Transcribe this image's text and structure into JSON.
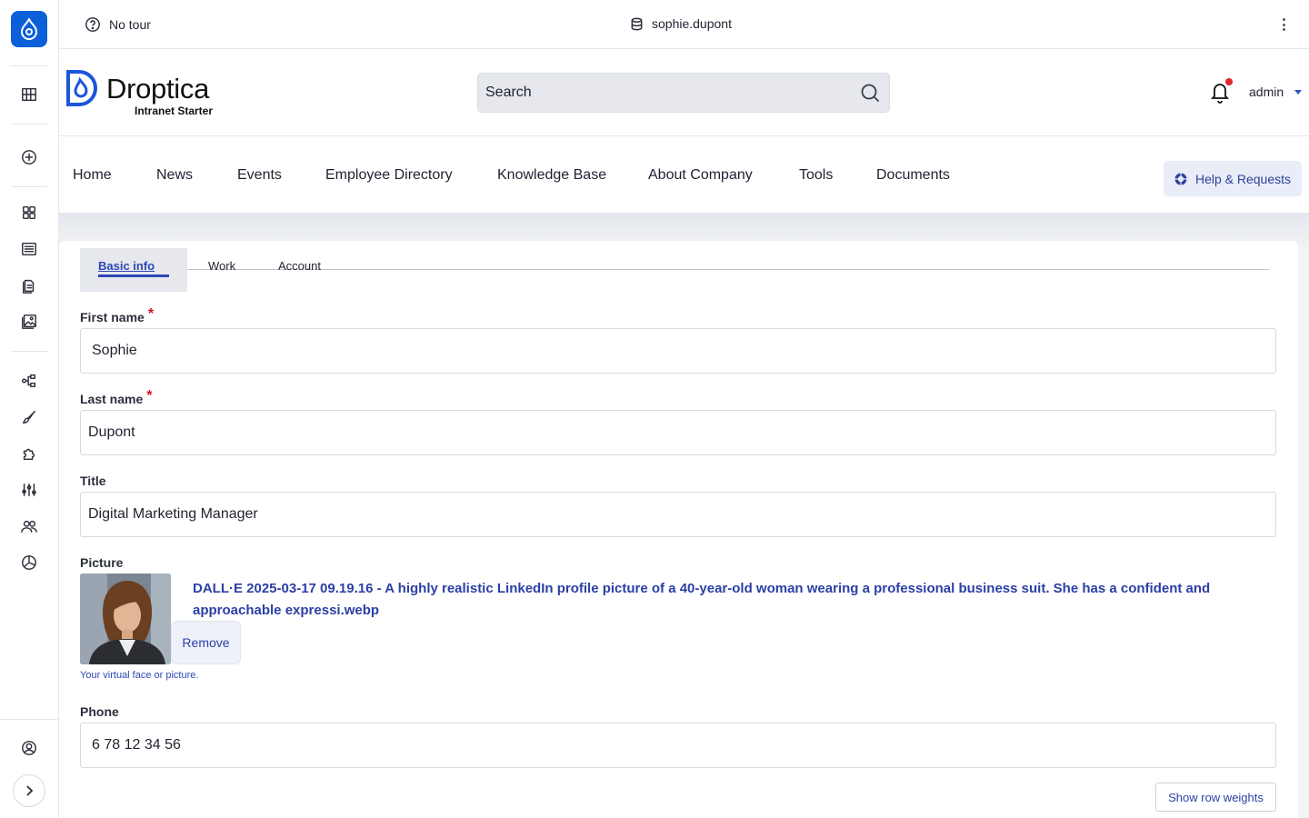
{
  "toolbar": {
    "tour_label": "No tour",
    "current_user": "sophie.dupont"
  },
  "sidebar": {
    "icons": [
      "drupal-logo-icon",
      "layout-icon",
      "add-icon",
      "dashboard-icon",
      "content-icon",
      "files-icon",
      "media-icon",
      "structure-icon",
      "appearance-icon",
      "extend-icon",
      "configuration-icon",
      "people-icon",
      "reports-icon",
      "user-icon",
      "expand-icon"
    ]
  },
  "header": {
    "brand_name": "Droptica",
    "brand_subtitle": "Intranet Starter",
    "search_placeholder": "Search",
    "user_menu": "admin"
  },
  "nav": {
    "items": [
      "Home",
      "News",
      "Events",
      "Employee Directory",
      "Knowledge Base",
      "About Company",
      "Tools",
      "Documents"
    ],
    "help_button": "Help & Requests"
  },
  "tabs": {
    "basic_info": "Basic info",
    "work": "Work",
    "account": "Account"
  },
  "form": {
    "first_name_label": "First name",
    "first_name_value": "Sophie",
    "last_name_label": "Last name",
    "last_name_value": "Dupont",
    "title_label": "Title",
    "title_value": "Digital Marketing Manager",
    "picture_label": "Picture",
    "picture_file": "DALL·E 2025-03-17 09.19.16 - A highly realistic LinkedIn profile picture of a 40-year-old woman wearing a professional business suit. She has a confident and approachable expressi.webp",
    "remove_button": "Remove",
    "picture_hint": "Your virtual face or picture.",
    "phone_label": "Phone",
    "phone_value": "6 78 12 34 56",
    "row_weights_button": "Show row weights"
  },
  "colors": {
    "accent": "#2c47b5",
    "brand_blue": "#0b5fd8",
    "required": "#d0141c",
    "notification": "#e0262b"
  }
}
